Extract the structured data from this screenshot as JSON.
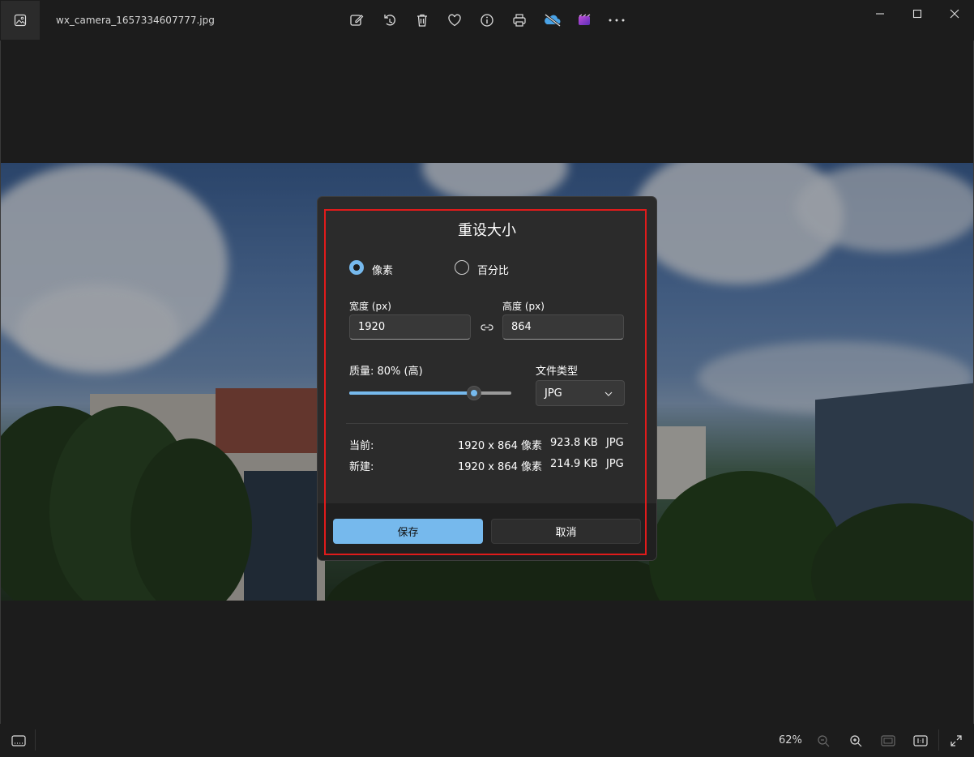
{
  "window": {
    "file_name": "wx_camera_1657334607777.jpg"
  },
  "toolbar": {
    "icons": [
      "edit-icon",
      "rotate-icon",
      "delete-icon",
      "favorite-icon",
      "info-icon",
      "print-icon",
      "onedrive-sync-off-icon",
      "clipchamp-icon",
      "more-icon"
    ]
  },
  "dialog": {
    "title": "重设大小",
    "mode_pixels": "像素",
    "mode_percent": "百分比",
    "selected_mode": "像素",
    "width_label": "宽度 (px)",
    "width_value": "1920",
    "height_label": "高度 (px)",
    "height_value": "864",
    "quality_label": "质量: 80% (高)",
    "quality_value": 0.8,
    "filetype_label": "文件类型",
    "filetype_value": "JPG",
    "current_label": "当前:",
    "current_dims": "1920 x 864 像素",
    "current_size": "923.8 KB",
    "current_type": "JPG",
    "new_label": "新建:",
    "new_dims": "1920 x 864 像素",
    "new_size": "214.9 KB",
    "new_type": "JPG",
    "save_label": "保存",
    "cancel_label": "取消",
    "accent_color": "#76b9ed",
    "highlight_color": "#e11b1b"
  },
  "statusbar": {
    "zoom": "62%"
  }
}
